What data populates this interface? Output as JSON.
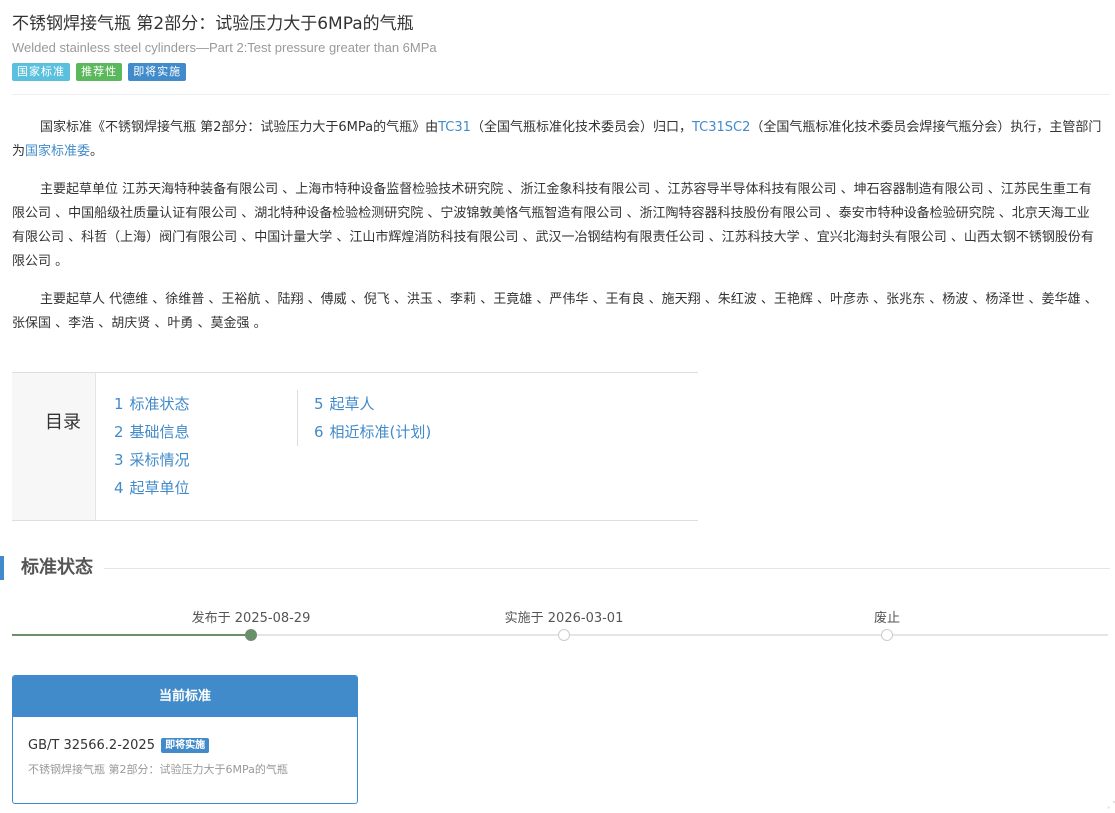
{
  "header": {
    "title_zh": "不锈钢焊接气瓶 第2部分：试验压力大于6MPa的气瓶",
    "title_en": "Welded stainless steel cylinders—Part 2:Test pressure greater than 6MPa",
    "tags": [
      "国家标准",
      "推荐性",
      "即将实施"
    ]
  },
  "intro": {
    "prefix": "国家标准《不锈钢焊接气瓶 第2部分：试验压力大于6MPa的气瓶》由",
    "tc1": "TC31",
    "tc1_name": "（全国气瓶标准化技术委员会）归口，",
    "tc2": "TC31SC2",
    "tc2_name": "（全国气瓶标准化技术委员会焊接气瓶分会）执行，主管部门为",
    "dept": "国家标准委",
    "suffix": "。"
  },
  "drafting_units": "主要起草单位 江苏天海特种装备有限公司 、上海市特种设备监督检验技术研究院 、浙江金象科技有限公司 、江苏容导半导体科技有限公司 、坤石容器制造有限公司 、江苏民生重工有限公司 、中国船级社质量认证有限公司 、湖北特种设备检验检测研究院 、宁波锦敦美恪气瓶智造有限公司 、浙江陶特容器科技股份有限公司 、泰安市特种设备检验研究院 、北京天海工业有限公司 、科哲（上海）阀门有限公司 、中国计量大学 、江山市辉煌消防科技有限公司 、武汉一冶钢结构有限责任公司 、江苏科技大学 、宜兴北海封头有限公司 、山西太钢不锈钢股份有限公司 。",
  "drafters": "主要起草人 代德维 、徐维普 、王裕航 、陆翔 、傅威 、倪飞 、洪玉 、李莉 、王竟雄 、严伟华 、王有良 、施天翔 、朱红波 、王艳辉 、叶彦赤 、张兆东 、杨波 、杨泽世 、姜华雄 、张保国 、李浩 、胡庆贤 、叶勇 、莫金强 。",
  "toc": {
    "title": "目录",
    "items": [
      {
        "num": "1",
        "label": "标准状态"
      },
      {
        "num": "2",
        "label": "基础信息"
      },
      {
        "num": "3",
        "label": "采标情况"
      },
      {
        "num": "4",
        "label": "起草单位"
      },
      {
        "num": "5",
        "label": "起草人"
      },
      {
        "num": "6",
        "label": "相近标准(计划)"
      }
    ]
  },
  "status_section": {
    "title": "标准状态",
    "timeline": [
      {
        "label": "发布于 2025-08-29",
        "done": true
      },
      {
        "label": "实施于 2026-03-01",
        "done": false
      },
      {
        "label": "废止",
        "done": false
      }
    ]
  },
  "current_card": {
    "header": "当前标准",
    "code": "GB/T 32566.2-2025",
    "badge": "即将实施",
    "name": "不锈钢焊接气瓶 第2部分：试验压力大于6MPa的气瓶"
  },
  "colors": {
    "primary": "#428bca",
    "info": "#5bc0de",
    "success": "#5cb85c",
    "timeline_done": "#6a8f6a"
  }
}
